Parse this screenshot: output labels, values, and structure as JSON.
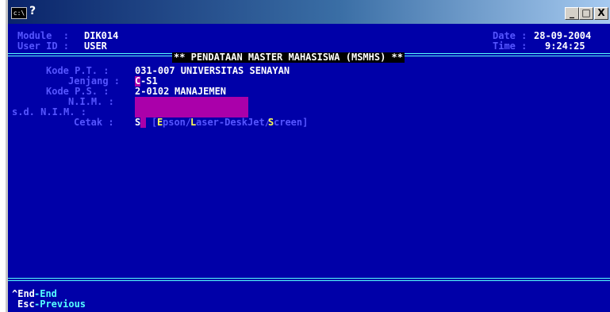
{
  "window": {
    "title": "?",
    "sys_icon": "c:\\",
    "buttons": {
      "minimize": "_",
      "maximize": "□",
      "close": "X"
    }
  },
  "header": {
    "module_label": "Module  :",
    "module_value": "DIK014",
    "user_label": "User ID :",
    "user_value": "USER",
    "date_label": "Date :",
    "date_value": "28-09-2004",
    "time_label": "Time :",
    "time_value": "9:24:25",
    "banner": "** PENDATAAN MASTER MAHASISWA (MSMHS) **"
  },
  "form": {
    "kode_pt_label": "Kode P.T. :",
    "kode_pt_value": "031-007 UNIVERSITAS SENAYAN",
    "jenjang_label": "Jenjang :",
    "jenjang_code": "C",
    "jenjang_rest": "-S1",
    "kode_ps_label": "Kode P.S. :",
    "kode_ps_code": "2-0102",
    "kode_ps_name": "MANAJEMEN",
    "nim_label": "N.I.M. :",
    "nim_value": "",
    "sd_nim_label": "s.d. N.I.M. :",
    "sd_nim_value": "",
    "cetak_label": "Cetak :",
    "cetak_value": "S",
    "cetak_options": {
      "open": "[",
      "e": "E",
      "e_rest": "pson/",
      "l": "L",
      "l_rest": "aser-DeskJet/",
      "s": "S",
      "s_rest": "creen]"
    }
  },
  "footer": {
    "end_key": "^End",
    "end_label": "-End",
    "esc_key": "Esc",
    "esc_label": "-Previous"
  },
  "colors": {
    "background": "#0000a8",
    "label": "#5555ff",
    "value": "#ffffff",
    "highlight": "#ffff55",
    "line": "#55ffff",
    "input_field": "#aa00aa"
  }
}
